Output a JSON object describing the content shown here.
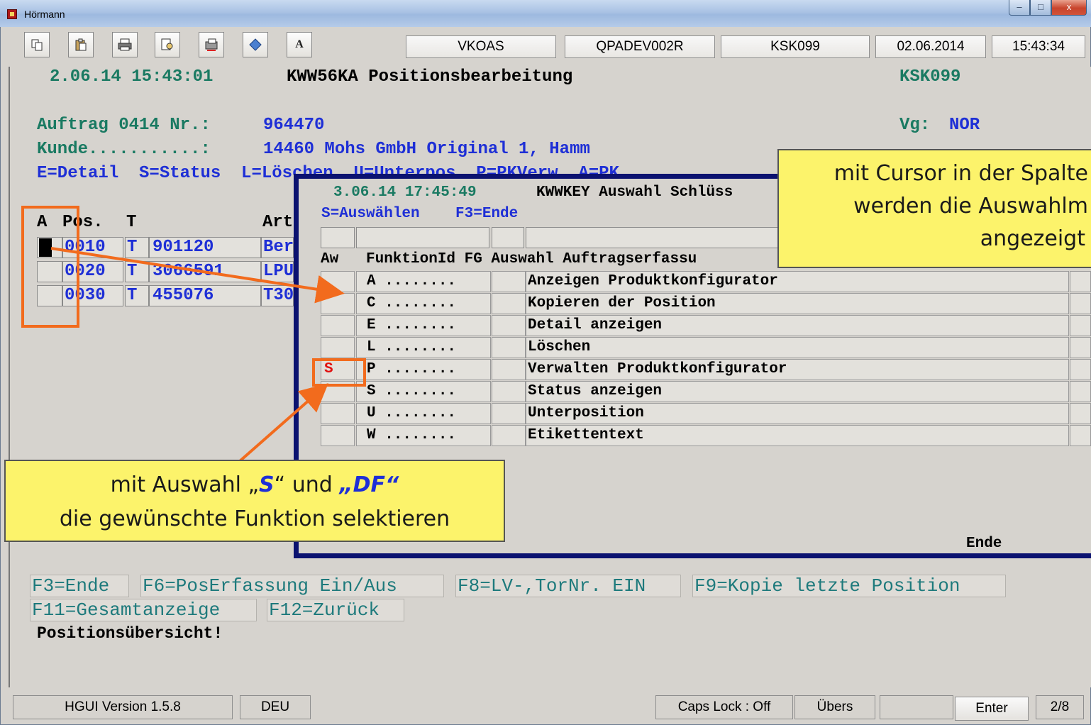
{
  "window": {
    "title": "Hörmann",
    "minimize": "–",
    "maximize": "□",
    "close": "x"
  },
  "toolbar": {
    "buttons": [
      "copy-icon",
      "paste-icon",
      "print-icon",
      "print-preview-icon",
      "clipboard-print-icon",
      "diamond-icon",
      "font-icon"
    ],
    "font_label": "A",
    "fields": [
      "VKOAS",
      "QPADEV002R",
      "KSK099",
      "02.06.2014",
      "15:43:34"
    ]
  },
  "header": {
    "datetime": "2.06.14 15:43:01",
    "program": "KWW56KA Positionsbearbeitung",
    "user": "KSK099"
  },
  "order": {
    "auftrag_label": "Auftrag 0414 Nr.:",
    "auftrag_value": "964470",
    "vg_label": "Vg:",
    "vg_value": "NOR",
    "kunde_label": "Kunde...........:",
    "kunde_value": "14460 Mohs GmbH Original 1, Hamm",
    "options": "E=Detail  S=Status  L=Löschen  U=Unterpos  P=PKVerw  A=PK"
  },
  "table": {
    "headers": {
      "a": "A",
      "pos": "Pos.",
      "t": "T",
      "art": "Art"
    },
    "rows": [
      {
        "pos": "0010",
        "t": "T",
        "num": "901120",
        "art": "Ber"
      },
      {
        "pos": "0020",
        "t": "T",
        "num": "3066591",
        "art": "LPU"
      },
      {
        "pos": "0030",
        "t": "T",
        "num": "455076",
        "art": "T30"
      }
    ]
  },
  "popup": {
    "datetime": "3.06.14 17:45:49",
    "title": "KWWKEY Auswahl Schlüss",
    "options": "S=Auswählen    F3=Ende",
    "col_aw": "Aw",
    "col_funktion": "FunktionId FG Auswahl Auftragserfassu",
    "rows": [
      {
        "sel": "",
        "id": "A ........",
        "label": "Anzeigen Produktkonfigurator"
      },
      {
        "sel": "",
        "id": "C ........",
        "label": "Kopieren der Position"
      },
      {
        "sel": "",
        "id": "E ........",
        "label": "Detail anzeigen"
      },
      {
        "sel": "",
        "id": "L ........",
        "label": "Löschen"
      },
      {
        "sel": "S",
        "id": "P ........",
        "label": "Verwalten Produktkonfigurator"
      },
      {
        "sel": "",
        "id": "S ........",
        "label": "Status anzeigen"
      },
      {
        "sel": "",
        "id": "U ........",
        "label": "Unterposition"
      },
      {
        "sel": "",
        "id": "W ........",
        "label": "Etikettentext"
      }
    ],
    "footer": "Ende"
  },
  "fkeys": {
    "row1": [
      "F3=Ende",
      "F6=PosErfassung Ein/Aus",
      "F8=LV-,TorNr. EIN",
      "F9=Kopie letzte Position"
    ],
    "row2": [
      "F11=Gesamtanzeige",
      "F12=Zurück"
    ]
  },
  "message": "Positionsübersicht!",
  "status": {
    "version": "HGUI Version 1.5.8",
    "lang": "DEU",
    "caps": "Caps Lock : Off",
    "mode": "Übers",
    "empty": "",
    "enter": "Enter",
    "page": "2/8"
  },
  "callouts": {
    "top": {
      "line1": "mit Cursor in der Spalte",
      "line2": "werden die Auswahlm",
      "line3": "angezeigt"
    },
    "bottom": {
      "pre": "mit Auswahl „",
      "s": "S",
      "mid": "“ und ",
      "df": "„DF“",
      "line2": "die gewünschte Funktion selektieren"
    }
  },
  "colors": {
    "accent_orange": "#f26b1d",
    "callout_yellow": "#fcf36b",
    "popup_border": "#0b1270",
    "field_blue": "#1e2fd6",
    "label_green": "#1a7a62"
  }
}
